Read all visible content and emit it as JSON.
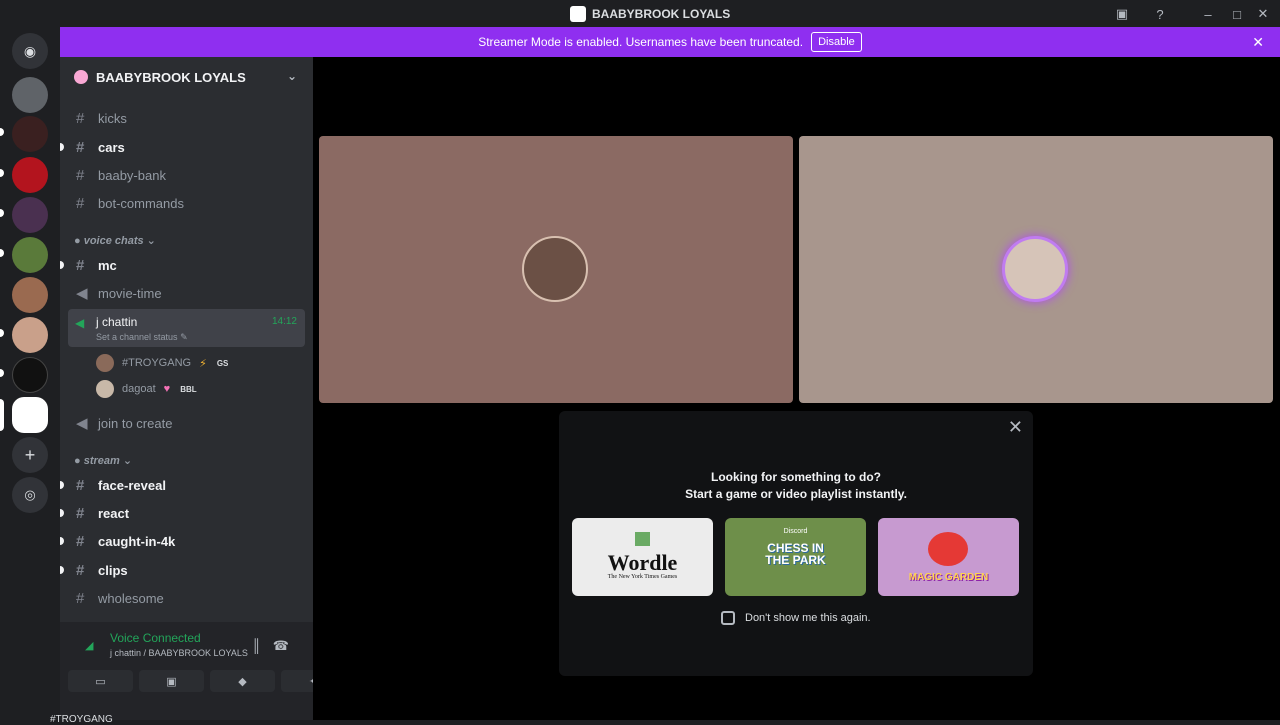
{
  "window": {
    "title": "BAABYBROOK LOYALS"
  },
  "banner": {
    "text": "Streamer Mode is enabled. Usernames have been truncated.",
    "disable_label": "Disable"
  },
  "server": {
    "name": "BAABYBROOK LOYALS"
  },
  "channels": {
    "kicks": "kicks",
    "cars": "cars",
    "baaby_bank": "baaby-bank",
    "bot_commands": "bot-commands",
    "voice_category": "voice chats",
    "mc": "mc",
    "movie_time": "movie-time",
    "j_chattin": {
      "name": "j chattin",
      "status": "Set a channel status",
      "time": "14:12"
    },
    "members": [
      {
        "name": "#TROYGANG",
        "tag": "GS"
      },
      {
        "name": "dagoat",
        "tag": "BBL"
      }
    ],
    "join_to_create": "join to create",
    "stream_category": "stream",
    "face_reveal": "face-reveal",
    "react": "react",
    "caught_in_4k": "caught-in-4k",
    "clips": "clips",
    "wholesome": "wholesome",
    "cut_off": "#TROYGANG"
  },
  "voice": {
    "status": "Voice Connected",
    "location": "j chattin / BAABYBROOK LOYALS"
  },
  "activity": {
    "line1": "Looking for something to do?",
    "line2": "Start a game or video playlist instantly.",
    "games": [
      {
        "name": "Wordle",
        "publisher": "The New York Times Games"
      },
      {
        "name": "CHESS IN THE PARK",
        "publisher": "Discord"
      },
      {
        "name": "MAGIC GARDEN"
      }
    ],
    "dont_show": "Don't show me this again."
  },
  "colors": {
    "accent": "#8f2ff0",
    "green": "#23a55a"
  }
}
